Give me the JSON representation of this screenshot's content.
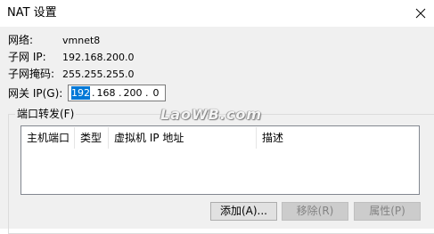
{
  "window": {
    "title": "NAT 设置"
  },
  "info": {
    "network_label": "网络:",
    "network_value": "vmnet8",
    "subnet_ip_label": "子网 IP:",
    "subnet_ip_value": "192.168.200.0",
    "subnet_mask_label": "子网掩码:",
    "subnet_mask_value": "255.255.255.0",
    "gateway_label": "网关 IP(G):"
  },
  "gateway_ip": {
    "octet1": "192",
    "octet2": "168",
    "octet3": "200",
    "octet4": "0",
    "separator": "."
  },
  "port_forwarding": {
    "group_label": "端口转发(F)",
    "columns": [
      "主机端口",
      "类型",
      "虚拟机 IP 地址",
      "描述"
    ],
    "rows": []
  },
  "buttons": {
    "add_label": "添加(A)...",
    "remove_label": "移除(R)",
    "properties_label": "属性(P)"
  },
  "watermark": {
    "text": "LaoWB.com"
  },
  "colors": {
    "selection": "#0078d7",
    "dialog_bg": "#f0f0f0",
    "disabled_text": "#838383"
  },
  "icons": {
    "close": "close-icon"
  }
}
